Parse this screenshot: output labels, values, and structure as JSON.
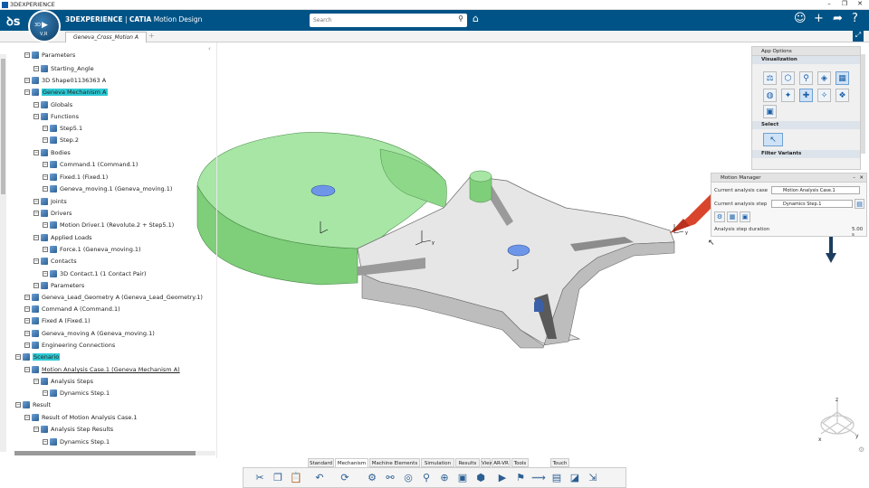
{
  "window": {
    "title": "3DEXPERIENCE",
    "controls": [
      "–",
      "❐",
      "✕"
    ]
  },
  "app": {
    "brand_prefix": "3DEXPERIENCE",
    "brand_sep": " | ",
    "brand_app": "CATIA",
    "brand_role": " Motion Design",
    "compass_play": "▶",
    "compass_label": "V,R",
    "compass_side": "3D"
  },
  "search": {
    "placeholder": "Search",
    "icon": "magnifier-icon"
  },
  "topbar_icons": [
    "user-icon",
    "plus-icon",
    "share-icon",
    "help-icon"
  ],
  "document": {
    "tab_label": "Geneva_Cross_Motion A",
    "add_tab": "+"
  },
  "tree": {
    "nodes": [
      {
        "label": "Parameters",
        "indent": 3
      },
      {
        "label": "Starting_Angle",
        "indent": 5
      },
      {
        "label": "3D Shape01136363 A",
        "indent": 3
      },
      {
        "label": "Geneva Mechanism A",
        "indent": 3
      },
      {
        "label": "Globals",
        "indent": 5
      },
      {
        "label": "Functions",
        "indent": 5
      },
      {
        "label": "Step5.1",
        "indent": 7
      },
      {
        "label": "Step.2",
        "indent": 7
      },
      {
        "label": "Bodies",
        "indent": 5
      },
      {
        "label": "Command.1 (Command.1)",
        "indent": 7
      },
      {
        "label": "Fixed.1 (Fixed.1)",
        "indent": 7
      },
      {
        "label": "Geneva_moving.1 (Geneva_moving.1)",
        "indent": 7
      },
      {
        "label": "Joints",
        "indent": 5
      },
      {
        "label": "Drivers",
        "indent": 5
      },
      {
        "label": "Motion Driver.1 (Revolute.2 + Step5.1)",
        "indent": 7
      },
      {
        "label": "Applied Loads",
        "indent": 5
      },
      {
        "label": "Force.1 (Geneva_moving.1)",
        "indent": 7
      },
      {
        "label": "Contacts",
        "indent": 5
      },
      {
        "label": "3D Contact.1 (1 Contact Pair)",
        "indent": 7
      },
      {
        "label": "Parameters",
        "indent": 5
      },
      {
        "label": "Geneva_Lead_Geometry A (Geneva_Lead_Geometry.1)",
        "indent": 3
      },
      {
        "label": "Command A (Command.1)",
        "indent": 3
      },
      {
        "label": "Fixed A (Fixed.1)",
        "indent": 3
      },
      {
        "label": "Geneva_moving A (Geneva_moving.1)",
        "indent": 3
      },
      {
        "label": "Engineering Connections",
        "indent": 3
      },
      {
        "label": "Scenario",
        "indent": 1
      },
      {
        "label": "Motion Analysis Case.1 (Geneva Mechanism A)",
        "indent": 3
      },
      {
        "label": "Analysis Steps",
        "indent": 5
      },
      {
        "label": "Dynamics Step.1",
        "indent": 7
      },
      {
        "label": "Result",
        "indent": 1
      },
      {
        "label": "Result of Motion Analysis Case.1",
        "indent": 3
      },
      {
        "label": "Analysis Step Results",
        "indent": 5
      },
      {
        "label": "Dynamics Step.1",
        "indent": 7
      }
    ]
  },
  "app_options": {
    "title": "App Options",
    "visualization_label": "Visualization",
    "select_label": "Select",
    "filter_label": "Filter Variants"
  },
  "motion_manager": {
    "title": "Motion Manager",
    "case_label": "Current analysis case",
    "case_value": "Motion Analysis Case.1",
    "step_label": "Current analysis step",
    "step_value": "Dynamics Step.1",
    "duration_label": "Analysis step duration",
    "duration_value": "5.00 s"
  },
  "bottom_tabs": [
    "Standard",
    "Mechanism",
    "Machine Elements",
    "Simulation",
    "Results",
    "View",
    "AR-VR",
    "Tools",
    "Touch"
  ],
  "active_bottom_tab": "Mechanism",
  "toolbar_icons": [
    "cut-icon",
    "copy-icon",
    "paste-icon",
    "undo-icon",
    "update-icon",
    "mechanism-icon",
    "joint-icon",
    "driver-icon",
    "contact-icon",
    "force-icon",
    "body-icon",
    "analysis-icon",
    "play-icon",
    "sensor-icon",
    "trace-icon",
    "plot-icon",
    "result-icon",
    "export-icon"
  ],
  "colors": {
    "appbar": "#005386",
    "highlight": "#2cc9d4",
    "green_part": "#9fe09c",
    "grey_part": "#e6e6e6"
  },
  "axis_labels": {
    "x": "x",
    "y": "y",
    "z": "z"
  }
}
